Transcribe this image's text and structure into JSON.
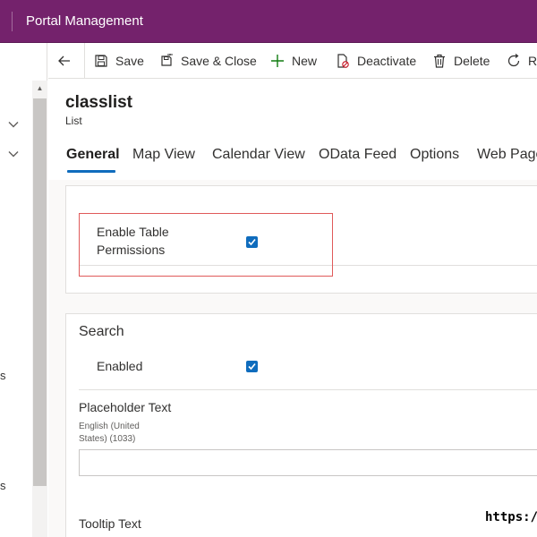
{
  "app": {
    "title": "Portal Management"
  },
  "left_nav": {
    "items": [
      "s",
      "s"
    ]
  },
  "command_bar": {
    "back_label": "",
    "save_label": "Save",
    "save_close_label": "Save & Close",
    "new_label": "New",
    "deactivate_label": "Deactivate",
    "delete_label": "Delete",
    "refresh_label": "Re"
  },
  "record": {
    "name": "classlist",
    "entity": "List"
  },
  "tabs": [
    "General",
    "Map View",
    "Calendar View",
    "OData Feed",
    "Options",
    "Web Page"
  ],
  "permissions_section": {
    "enable_table_permissions": {
      "label_line1": "Enable Table",
      "label_line2": "Permissions",
      "checked": true
    }
  },
  "search_section": {
    "title": "Search",
    "enabled": {
      "label": "Enabled",
      "checked": true
    },
    "placeholder_text": {
      "label": "Placeholder Text",
      "locale_line1": "English (United",
      "locale_line2": "States) (1033)",
      "value": ""
    },
    "tooltip_text": {
      "label": "Tooltip Text"
    }
  },
  "watermark": {
    "text": "https:/"
  },
  "colors": {
    "header_bg": "#74226c",
    "accent": "#0f6cbd",
    "highlight": "#e05a5a"
  }
}
